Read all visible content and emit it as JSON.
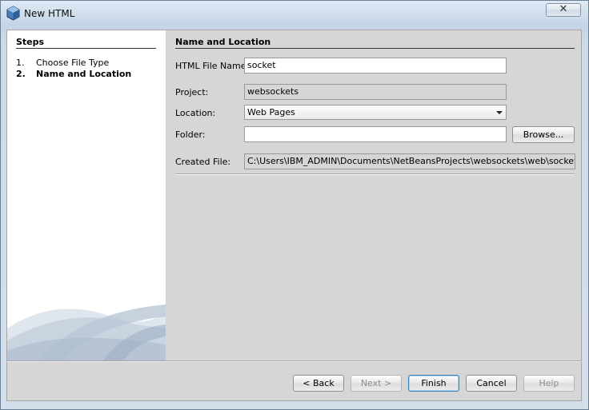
{
  "window": {
    "title": "New HTML",
    "close_label": "✕"
  },
  "steps": {
    "heading": "Steps",
    "items": [
      {
        "num": "1.",
        "label": "Choose File Type"
      },
      {
        "num": "2.",
        "label": "Name and Location"
      }
    ]
  },
  "panel": {
    "heading": "Name and Location",
    "file_name_label": "HTML File Name:",
    "file_name_value": "socket",
    "project_label": "Project:",
    "project_value": "websockets",
    "location_label": "Location:",
    "location_value": "Web Pages",
    "folder_label": "Folder:",
    "folder_value": "",
    "browse_label": "Browse...",
    "created_label": "Created File:",
    "created_value": "C:\\Users\\IBM_ADMIN\\Documents\\NetBeansProjects\\websockets\\web\\socket.html"
  },
  "buttons": {
    "back": "< Back",
    "next": "Next >",
    "finish": "Finish",
    "cancel": "Cancel",
    "help": "Help"
  }
}
